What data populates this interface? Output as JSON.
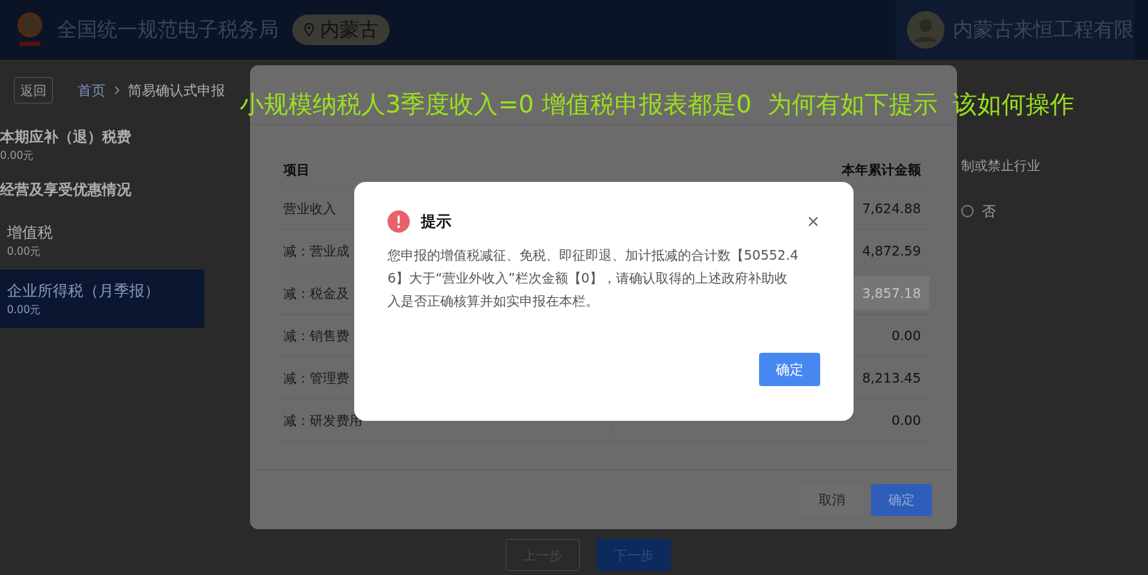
{
  "header": {
    "title": "全国统一规范电子税务局",
    "region": "内蒙古",
    "user": "内蒙古来恒工程有限"
  },
  "breadcrumb": {
    "back": "返回",
    "items": [
      "首页",
      "简易确认式申报"
    ]
  },
  "sidebar": {
    "summary": {
      "title": "本期应补（退）税费",
      "amount": "0.00元"
    },
    "section": "经营及享受优惠情况",
    "items": [
      {
        "label": "增值税",
        "amount": "0.00元",
        "selected": false
      },
      {
        "label": "企业所得税（月季报）",
        "amount": "0.00元",
        "selected": true
      }
    ]
  },
  "content": {
    "fragment": "制或禁止行业",
    "radio": {
      "label": "否",
      "checked": false
    }
  },
  "footer": {
    "buttons": [
      {
        "label": "上一步",
        "kind": "secondary"
      },
      {
        "label": "下一步",
        "kind": "primary"
      }
    ]
  },
  "profit_dialog": {
    "columns": [
      "项目",
      "本年累计金额"
    ],
    "rows": [
      {
        "item": "营业收入",
        "amount": "7,624.88",
        "disabled": false
      },
      {
        "item": "减：营业成",
        "amount": "4,872.59",
        "disabled": false
      },
      {
        "item": "减：税金及",
        "amount": "3,857.18",
        "disabled": true
      },
      {
        "item": "减：销售费",
        "amount": "0.00",
        "disabled": false
      },
      {
        "item": "减：管理费",
        "amount": "8,213.45",
        "disabled": false
      },
      {
        "item": "减：研发费用",
        "amount": "0.00",
        "disabled": false
      }
    ],
    "buttons": [
      {
        "label": "取消",
        "kind": "secondary"
      },
      {
        "label": "确定",
        "kind": "primary"
      }
    ]
  },
  "alert": {
    "title": "提示",
    "message": "您申报的增值税减征、免税、即征即退、加计抵减的合计数【50552.46】大于“营业外收入”栏次金额【0】，请确认取得的上述政府补助收入是否正确核算并如实申报在本栏。",
    "button": "确定"
  },
  "annotation": "小规模纳税人3季度收入=0 增值税申报表都是0  为何有如下提示  该如何操作"
}
